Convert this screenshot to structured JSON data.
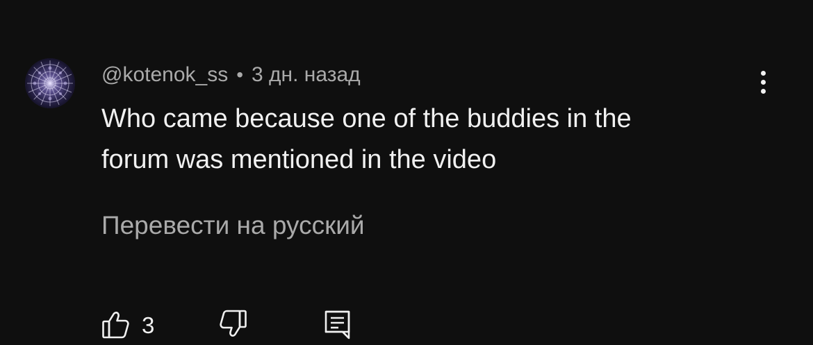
{
  "comment": {
    "author": "@kotenok_ss",
    "separator": "•",
    "time": "3 дн. назад",
    "text_lines": [
      "Who came because one of the buddies in the",
      "forum was mentioned in the video"
    ],
    "translate_label": "Перевести на русский",
    "likes": "3"
  },
  "icons": {
    "avatar": "rose-window-avatar",
    "menu": "more-vertical-icon",
    "like": "thumbs-up-icon",
    "dislike": "thumbs-down-icon",
    "reply": "comment-reply-icon"
  },
  "colors": {
    "background": "#0f0f0f",
    "primary_text": "#f1f1f1",
    "secondary_text": "#aaaaaa"
  }
}
